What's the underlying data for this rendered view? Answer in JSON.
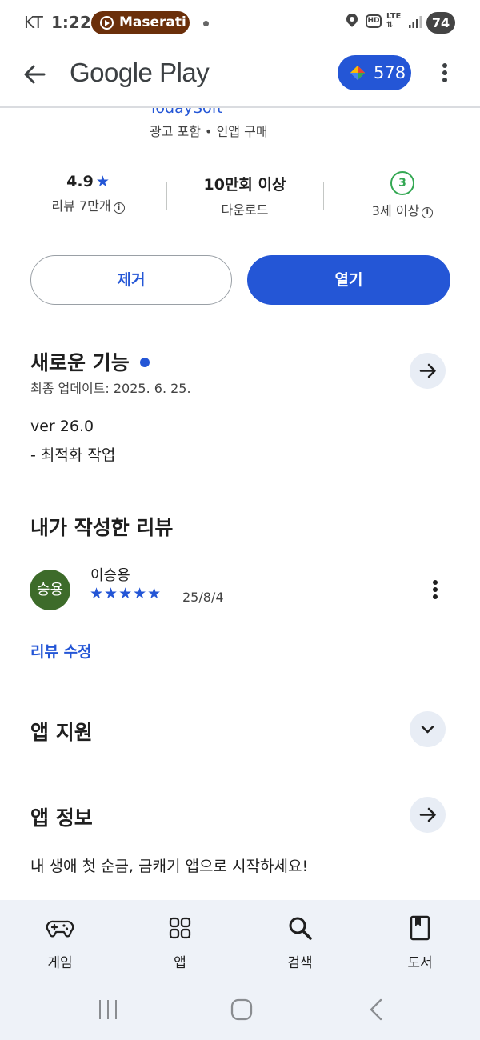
{
  "status_bar": {
    "carrier": "KT",
    "time": "1:22",
    "media_pill": "Maserati",
    "network_hd": "HD",
    "network_lte": "LTE",
    "battery": "74"
  },
  "app_bar": {
    "title": "Google Play",
    "points": "578"
  },
  "app_header": {
    "developer": "TodaySoft",
    "ads_note": "광고 포함 • 인앱 구매"
  },
  "stats": {
    "rating": "4.9",
    "rating_star": "★",
    "reviews": "리뷰 7만개",
    "downloads": "10만회 이상",
    "downloads_label": "다운로드",
    "age_badge": "3",
    "age_label": "3세 이상"
  },
  "actions": {
    "uninstall": "제거",
    "open": "열기"
  },
  "whats_new": {
    "title": "새로운 기능",
    "updated": "최종 업데이트: 2025. 6. 25.",
    "version": "ver 26.0",
    "notes": "- 최적화 작업"
  },
  "my_review": {
    "title": "내가 작성한 리뷰",
    "avatar_text": "승용",
    "avatar_color": "#3d6b2a",
    "author": "이승용",
    "stars": "★★★★★",
    "date": "25/8/4",
    "edit_link": "리뷰 수정"
  },
  "app_support": {
    "title": "앱 지원"
  },
  "about": {
    "title": "앱 정보",
    "description": "내 생애 첫 순금, 금캐기 앱으로 시작하세요!"
  },
  "bottom_nav": {
    "items": [
      {
        "label": "게임",
        "icon": "gamepad-icon"
      },
      {
        "label": "앱",
        "icon": "apps-grid-icon"
      },
      {
        "label": "검색",
        "icon": "search-icon"
      },
      {
        "label": "도서",
        "icon": "book-icon"
      }
    ]
  },
  "colors": {
    "accent": "#2456d6",
    "age_green": "#34a853",
    "nav_bg": "#eef2f8"
  }
}
